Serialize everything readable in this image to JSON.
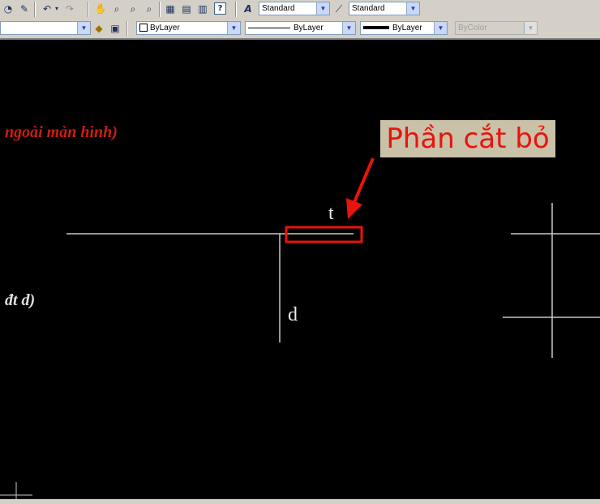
{
  "toolbar": {
    "text_style": "Standard",
    "dim_style": "Standard"
  },
  "properties": {
    "color": "ByLayer",
    "linetype": "ByLayer",
    "lineweight": "ByLayer",
    "plotstyle": "ByColor"
  },
  "drawing": {
    "red_note": "ngoài màn hình)",
    "white_note": "đt d)",
    "label_t": "t",
    "label_d": "d"
  },
  "callout": {
    "text": "Phần cắt bỏ"
  },
  "colors": {
    "callout_text": "#e8140c",
    "callout_bg": "#c9c1a8",
    "highlight_box": "#e8140c",
    "drawing_lines": "#c8c8c8",
    "red_note": "#c81e14",
    "canvas": "#000000"
  },
  "icons": [
    "undo-icon",
    "redo-icon",
    "pan-icon",
    "zoom-realtime-icon",
    "zoom-window-icon",
    "zoom-previous-icon",
    "properties-icon",
    "design-center-icon",
    "tool-palettes-icon",
    "help-icon",
    "text-style-icon",
    "dim-style-icon",
    "layer-icon"
  ]
}
